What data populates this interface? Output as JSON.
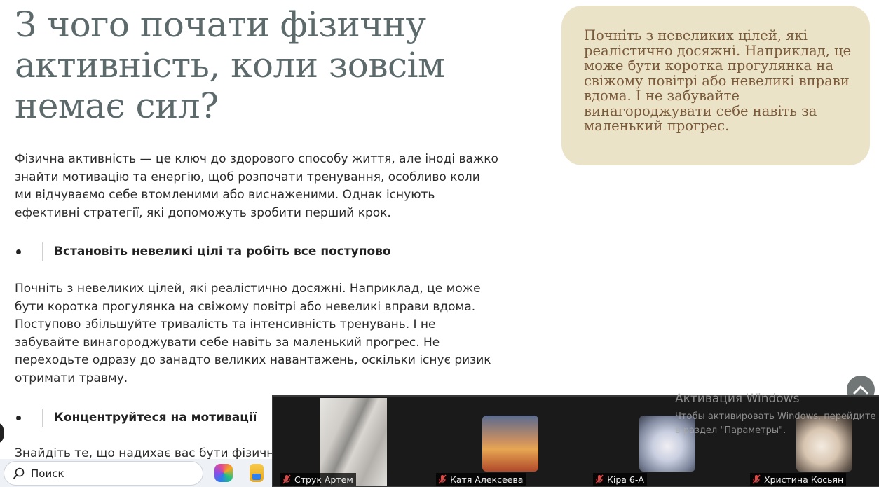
{
  "article": {
    "title": "З чого почати фізичну активність, коли зовсім немає сил?",
    "intro": "Фізична активність — це ключ до здорового способу життя, але іноді важко знайти мотивацію та енергію, щоб розпочати тренування, особливо коли ми відчуваємо себе втомленими або виснаженими. Однак існують ефективні стратегії, які допоможуть зробити перший крок.",
    "section1_heading": "Встановіть невеликі цілі та робіть все поступово",
    "section1_text": "Почніть з невеликих цілей, які реалістично досяжні. Наприклад, це може бути коротка прогулянка на свіжому повітрі або невеликі вправи вдома. Поступово збільшуйте тривалість та інтенсивність тренувань. І не забувайте винагороджувати себе навіть за маленький прогрес. Не переходьте одразу до занадто великих навантажень, оскільки існує ризик отримати травму.",
    "section2_heading": "Концентруйтеся на мотивації",
    "section2_text": "Знайдіть те, що надихає вас бути фізично"
  },
  "quote": {
    "text": "Почніть з невеликих цілей, які реалістично досяжні. Наприклад, це може бути коротка прогулянка на свіжому повітрі або невеликі вправи вдома. І не забувайте винагороджувати себе навіть за маленький прогрес."
  },
  "call": {
    "participants": [
      {
        "name": "Струк Артем",
        "muted": true
      },
      {
        "name": "Катя Алексеева",
        "muted": true
      },
      {
        "name": "Кіра 6-А",
        "muted": true
      },
      {
        "name": "Христина Косьян",
        "muted": true
      }
    ]
  },
  "windows_activation": {
    "title": "Активация Windows",
    "line1": "Чтобы активировать Windows, перейдите",
    "line2": "в раздел \"Параметры\"."
  },
  "taskbar": {
    "search_label": "Поиск"
  },
  "colors": {
    "title": "#5d6a6b",
    "quote_bg": "#ebe3c8",
    "quote_text": "#7b5a3a"
  }
}
